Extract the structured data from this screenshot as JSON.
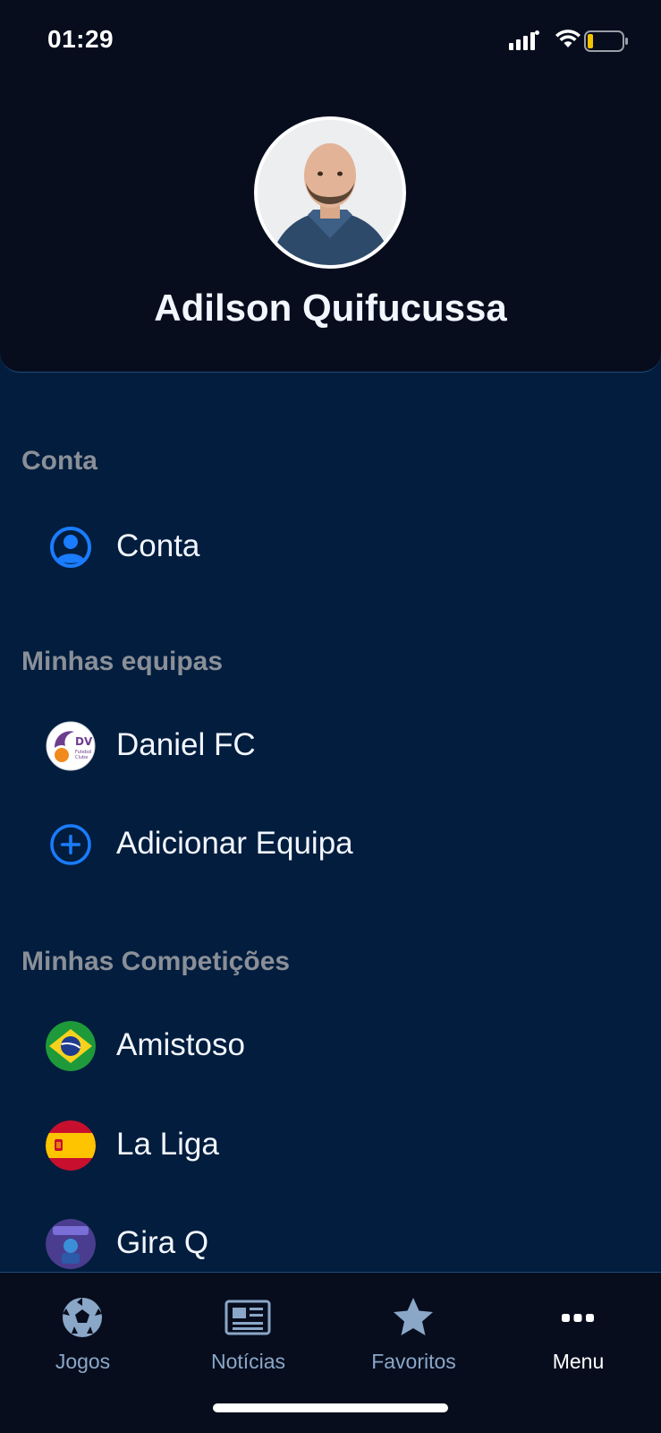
{
  "status_bar": {
    "time": "01:29"
  },
  "profile": {
    "name": "Adilson Quifucussa"
  },
  "sections": {
    "account": {
      "title": "Conta",
      "item_label": "Conta"
    },
    "teams": {
      "title": "Minhas equipas",
      "team_label": "Daniel FC",
      "add_label": "Adicionar Equipa"
    },
    "competitions": {
      "title": "Minhas Competições",
      "items": [
        "Amistoso",
        "La Liga",
        "Gira Q"
      ]
    }
  },
  "tabs": [
    {
      "label": "Jogos",
      "icon": "soccer-ball-icon"
    },
    {
      "label": "Notícias",
      "icon": "newspaper-icon"
    },
    {
      "label": "Favoritos",
      "icon": "star-icon"
    },
    {
      "label": "Menu",
      "icon": "more-icon",
      "active": true
    }
  ],
  "colors": {
    "background": "#021d3d",
    "header_background": "#070d1d",
    "accent": "#1a7cff",
    "section_title": "#8a8f98",
    "tab_inactive": "#8aa7c8"
  }
}
